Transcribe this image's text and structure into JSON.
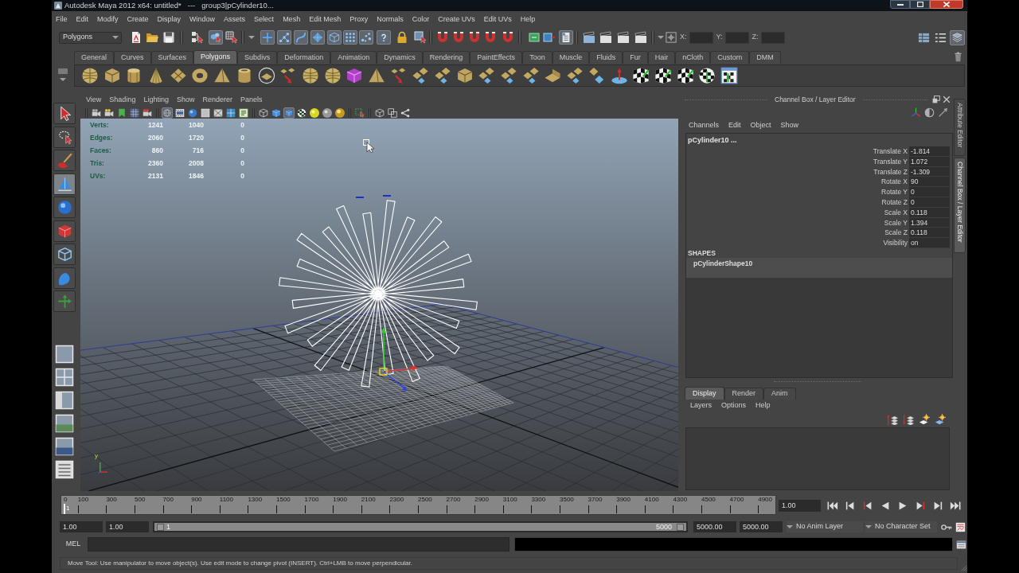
{
  "window": {
    "title": "Autodesk Maya 2012 x64: untitled*   ---   group3|pCylinder10..."
  },
  "menu_bar": [
    "File",
    "Edit",
    "Modify",
    "Create",
    "Display",
    "Window",
    "Assets",
    "Select",
    "Mesh",
    "Edit Mesh",
    "Proxy",
    "Normals",
    "Color",
    "Create UVs",
    "Edit UVs",
    "Help"
  ],
  "status_line": {
    "menu_set": "Polygons",
    "selection_modes": [
      {
        "selected": false
      },
      {
        "selected": true
      },
      {
        "selected": false
      }
    ],
    "component_masks": [
      {
        "on": true
      },
      {
        "on": true
      },
      {
        "on": true
      },
      {
        "on": true
      },
      {
        "on": true
      },
      {
        "on": true
      },
      {
        "on": true
      },
      {
        "on": true
      }
    ],
    "history_buttons": [
      {
        "on": false
      },
      {
        "on": false
      },
      {
        "on": true
      }
    ],
    "coordinate_fields": [
      {
        "label": "X:"
      },
      {
        "label": "Y:"
      },
      {
        "label": "Z:"
      }
    ],
    "panel_toggles": [
      {
        "on": false
      },
      {
        "on": false
      },
      {
        "on": true
      }
    ]
  },
  "shelf": {
    "tabs": [
      {
        "label": "General",
        "selected": false
      },
      {
        "label": "Curves",
        "selected": false
      },
      {
        "label": "Surfaces",
        "selected": false
      },
      {
        "label": "Polygons",
        "selected": true
      },
      {
        "label": "Subdivs",
        "selected": false
      },
      {
        "label": "Deformation",
        "selected": false
      },
      {
        "label": "Animation",
        "selected": false
      },
      {
        "label": "Dynamics",
        "selected": false
      },
      {
        "label": "Rendering",
        "selected": false
      },
      {
        "label": "PaintEffects",
        "selected": false
      },
      {
        "label": "Toon",
        "selected": false
      },
      {
        "label": "Muscle",
        "selected": false
      },
      {
        "label": "Fluids",
        "selected": false
      },
      {
        "label": "Fur",
        "selected": false
      },
      {
        "label": "Hair",
        "selected": false
      },
      {
        "label": "nCloth",
        "selected": false
      },
      {
        "label": "Custom",
        "selected": false
      },
      {
        "label": "DMM",
        "selected": false
      }
    ]
  },
  "toolbox": {
    "tools": [
      {
        "selected": false
      },
      {
        "selected": false
      },
      {
        "selected": false
      },
      {
        "selected": true
      },
      {
        "selected": false
      },
      {
        "selected": false
      },
      {
        "selected": false
      },
      {
        "selected": false
      },
      {
        "selected": false
      }
    ]
  },
  "viewport": {
    "menu": [
      "View",
      "Shading",
      "Lighting",
      "Show",
      "Renderer",
      "Panels"
    ],
    "toolbar_toggles": [
      {
        "on": true
      },
      {
        "on": false
      },
      {
        "on": false
      },
      {
        "on": false
      },
      {
        "on": false
      },
      {
        "on": false
      },
      {
        "on": false
      },
      {
        "on": false
      },
      {
        "on": false
      },
      {
        "on": true
      },
      {
        "on": false
      },
      {
        "on": false
      },
      {
        "on": false
      },
      {
        "on": false
      }
    ],
    "hud": [
      {
        "label": "Verts:",
        "values": [
          "1241",
          "1040",
          "0"
        ]
      },
      {
        "label": "Edges:",
        "values": [
          "2060",
          "1720",
          "0"
        ]
      },
      {
        "label": "Faces:",
        "values": [
          "860",
          "716",
          "0"
        ]
      },
      {
        "label": "Tris:",
        "values": [
          "2360",
          "2008",
          "0"
        ]
      },
      {
        "label": "UVs:",
        "values": [
          "2131",
          "1846",
          "0"
        ]
      }
    ],
    "axis_label": "y"
  },
  "channel_box": {
    "title": "Channel Box / Layer Editor",
    "menu": [
      "Channels",
      "Edit",
      "Object",
      "Show"
    ],
    "object_name": "pCylinder10 ...",
    "channels": [
      {
        "name": "Translate X",
        "value": "-1.814"
      },
      {
        "name": "Translate Y",
        "value": "1.072"
      },
      {
        "name": "Translate Z",
        "value": "-1.309"
      },
      {
        "name": "Rotate X",
        "value": "90"
      },
      {
        "name": "Rotate Y",
        "value": "0"
      },
      {
        "name": "Rotate Z",
        "value": "0"
      },
      {
        "name": "Scale X",
        "value": "0.118"
      },
      {
        "name": "Scale Y",
        "value": "1.394"
      },
      {
        "name": "Scale Z",
        "value": "0.118"
      },
      {
        "name": "Visibility",
        "value": "on"
      }
    ],
    "shapes_heading": "SHAPES",
    "shapes": [
      "pCylinderShape10"
    ]
  },
  "layer_editor": {
    "tabs": [
      {
        "label": "Display",
        "selected": true
      },
      {
        "label": "Render",
        "selected": false
      },
      {
        "label": "Anim",
        "selected": false
      }
    ],
    "menu": [
      "Layers",
      "Options",
      "Help"
    ]
  },
  "side_tabs": [
    {
      "label": "Attribute Editor",
      "selected": false
    },
    {
      "label": "Channel Box / Layer Editor",
      "selected": true
    }
  ],
  "time_slider": {
    "ticks": [
      "0",
      "100",
      "300",
      "500",
      "700",
      "900",
      "1100",
      "1300",
      "1500",
      "1700",
      "1900",
      "2100",
      "2300",
      "2500",
      "2700",
      "2900",
      "3100",
      "3300",
      "3500",
      "3700",
      "3900",
      "4100",
      "4300",
      "4500",
      "4700",
      "4900"
    ],
    "level": 0,
    "current_frame": "1",
    "current_time": "1.00"
  },
  "range_slider": {
    "start_time": "1.00",
    "playback_start": "1.00",
    "range_start": "1",
    "range_end": "5000",
    "level": 1,
    "playback_end": "5000.00",
    "end_time": "5000.00",
    "anim_layer": "No Anim Layer",
    "character_set": "No Character Set"
  },
  "command_line": {
    "language": "MEL"
  },
  "help_line": "Move Tool: Use manipulator to move object(s). Use edit mode to change pivot (INSERT).  Ctrl+LMB to move perpendicular."
}
